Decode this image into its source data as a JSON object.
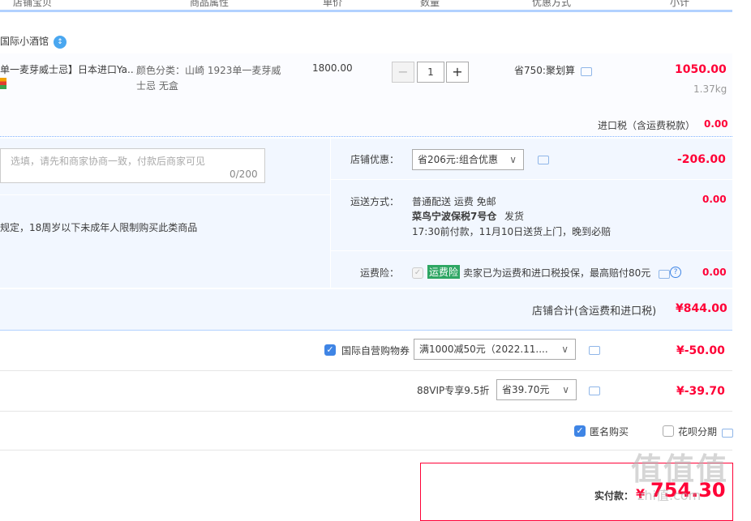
{
  "header": {
    "columns": [
      "店铺宝贝",
      "商品属性",
      "单价",
      "数量",
      "优惠方式",
      "小计"
    ]
  },
  "shop": {
    "name": "国际小酒馆",
    "badge": "↕"
  },
  "item": {
    "title": "单一麦芽威士忌】日本进口Ya...",
    "attr_line1": "颜色分类：山崎 1923单一麦芽威",
    "attr_line2": "士忌 无盒",
    "price": "1800.00",
    "qty_minus": "−",
    "qty": "1",
    "qty_plus": "+",
    "promo": "省750:聚划算",
    "subtotal": "1050.00",
    "weight": "1.37kg",
    "tax_label": "进口税（含运费税款）",
    "tax_value": "0.00"
  },
  "message": {
    "placeholder": "选填，请先和商家协商一致，付款后商家可见",
    "counter": "0/200",
    "notice": "规定，18周岁以下未成年人限制购买此类商品"
  },
  "shop_discount": {
    "label": "店铺优惠：",
    "selected": "省206元:组合优惠",
    "value": "-206.00"
  },
  "shipping": {
    "label": "运送方式：",
    "line1": "普通配送 运费 免邮",
    "warehouse": "菜鸟宁波保税7号仓",
    "ship_note": "发货",
    "line3": "17:30前付款，11月10日送货上门，晚到必赔",
    "value": "0.00"
  },
  "insurance": {
    "label": "运费险：",
    "tag": "运费险",
    "text": "卖家已为运费和进口税投保，最高赔付80元",
    "value": "0.00"
  },
  "shop_total": {
    "label": "店铺合计(含运费和进口税)",
    "value": "¥844.00"
  },
  "coupon": {
    "label": "国际自营购物券",
    "selected": "满1000减50元（2022.11....",
    "value": "¥-50.00",
    "checked": "✓"
  },
  "vip": {
    "label": "88VIP专享9.5折",
    "selected": "省39.70元",
    "value": "¥-39.70"
  },
  "options": {
    "anonymous": "匿名购买",
    "anonymous_check": "✓",
    "installment": "花呗分期"
  },
  "payment": {
    "label": "实付款：",
    "currency": "¥",
    "amount": "754.30"
  },
  "watermark": {
    "main": "值值值",
    "sub": "zhi值.com"
  },
  "colors": {
    "accent": "#ff0036",
    "blue": "#3f85e5",
    "panel": "#f2f7ff"
  }
}
